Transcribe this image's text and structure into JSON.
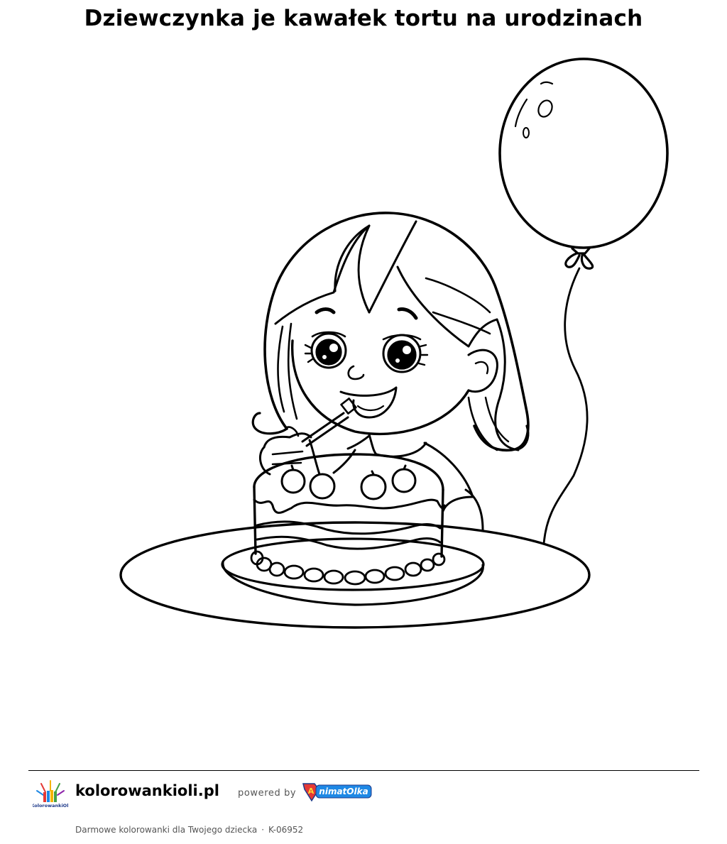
{
  "page": {
    "title": "Dziewczynka je kawałek tortu na urodzinach"
  },
  "artwork": {
    "subject": "coloring-page-line-art"
  },
  "footer": {
    "site_name": "kolorowankioli.pl",
    "powered_by": "powered by",
    "logo_text": "KolorowankiOli",
    "partner_logo_text": "AnimatOlka",
    "tagline": "Darmowe kolorowanki dla Twojego dziecka",
    "separator": "·",
    "code": "K-06952"
  },
  "colors": {
    "line": "#000000",
    "background": "#ffffff",
    "muted_text": "#555555",
    "animat_blue": "#1e88e5",
    "animat_red": "#e53935",
    "animat_yellow": "#fdd835"
  }
}
